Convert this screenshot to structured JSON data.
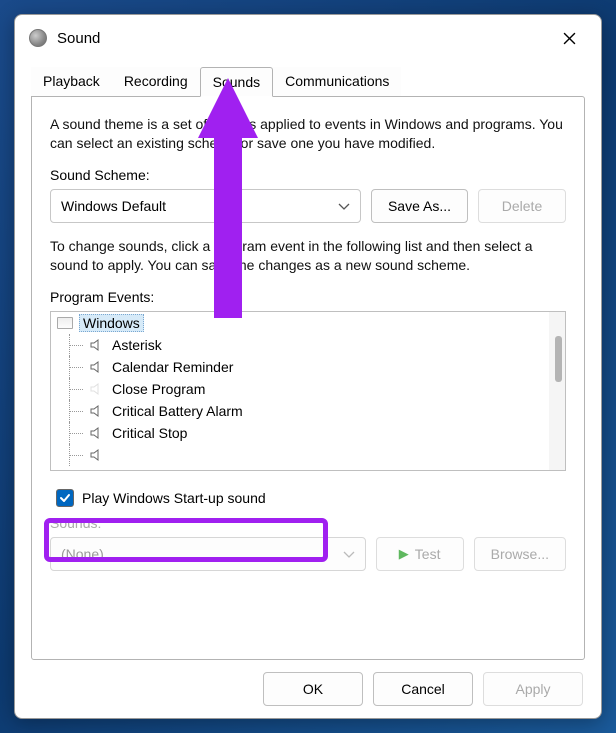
{
  "window": {
    "title": "Sound"
  },
  "tabs": {
    "items": [
      {
        "label": "Playback",
        "active": false
      },
      {
        "label": "Recording",
        "active": false
      },
      {
        "label": "Sounds",
        "active": true
      },
      {
        "label": "Communications",
        "active": false
      }
    ]
  },
  "description": "A sound theme is a set of sounds applied to events in Windows and programs.  You can select an existing scheme or save one you have modified.",
  "scheme": {
    "label": "Sound Scheme:",
    "value": "Windows Default",
    "save_as": "Save As...",
    "delete": "Delete"
  },
  "events_desc": "To change sounds, click a program event in the following list and then select a sound to apply. You can save the changes as a new sound scheme.",
  "events": {
    "label": "Program Events:",
    "root": "Windows",
    "items": [
      "Asterisk",
      "Calendar Reminder",
      "Close Program",
      "Critical Battery Alarm",
      "Critical Stop"
    ]
  },
  "startup": {
    "label": "Play Windows Start-up sound",
    "checked": true
  },
  "sounds": {
    "label": "Sounds:",
    "value": "(None)",
    "test": "Test",
    "browse": "Browse..."
  },
  "buttons": {
    "ok": "OK",
    "cancel": "Cancel",
    "apply": "Apply"
  }
}
